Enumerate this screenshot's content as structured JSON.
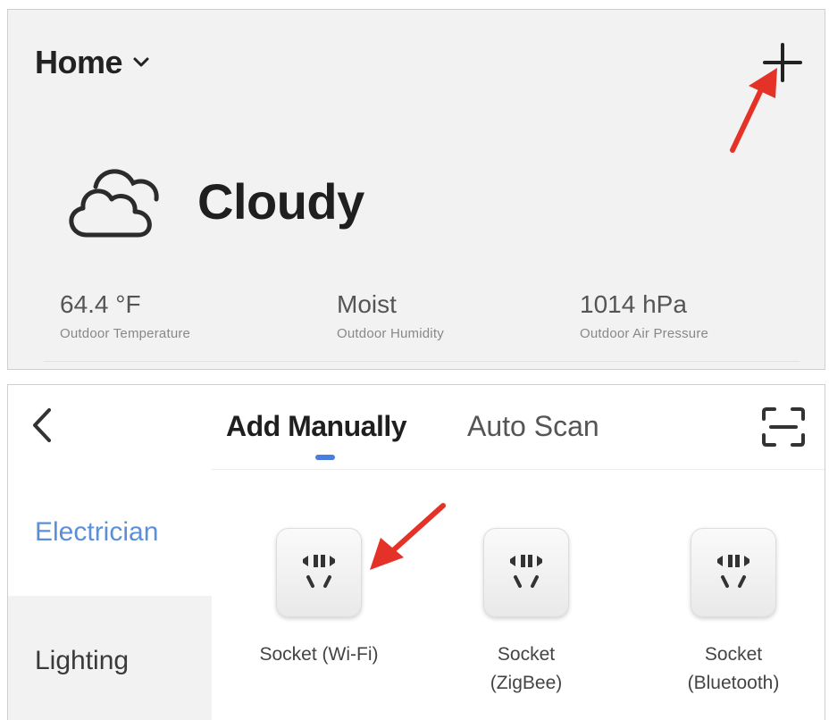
{
  "home": {
    "title": "Home",
    "weather": "Cloudy",
    "stats": [
      {
        "value": "64.4 °F",
        "label": "Outdoor Temperature"
      },
      {
        "value": "Moist",
        "label": "Outdoor Humidity"
      },
      {
        "value": "1014 hPa",
        "label": "Outdoor Air Pressure"
      }
    ]
  },
  "add_device": {
    "tabs": [
      "Add Manually",
      "Auto Scan"
    ],
    "categories": [
      "Electrician",
      "Lighting"
    ],
    "devices": [
      {
        "name": "Socket (Wi-Fi)"
      },
      {
        "name": "Socket\n(ZigBee)"
      },
      {
        "name": "Socket\n(Bluetooth)"
      }
    ]
  },
  "colors": {
    "accent": "#4a7de0",
    "category_active": "#5b8fd8",
    "annotation_arrow": "#e53228"
  },
  "icons": [
    "chevron-down-icon",
    "plus-icon",
    "cloud-icon",
    "back-icon",
    "scan-icon",
    "socket-icon",
    "annotation-arrow"
  ]
}
